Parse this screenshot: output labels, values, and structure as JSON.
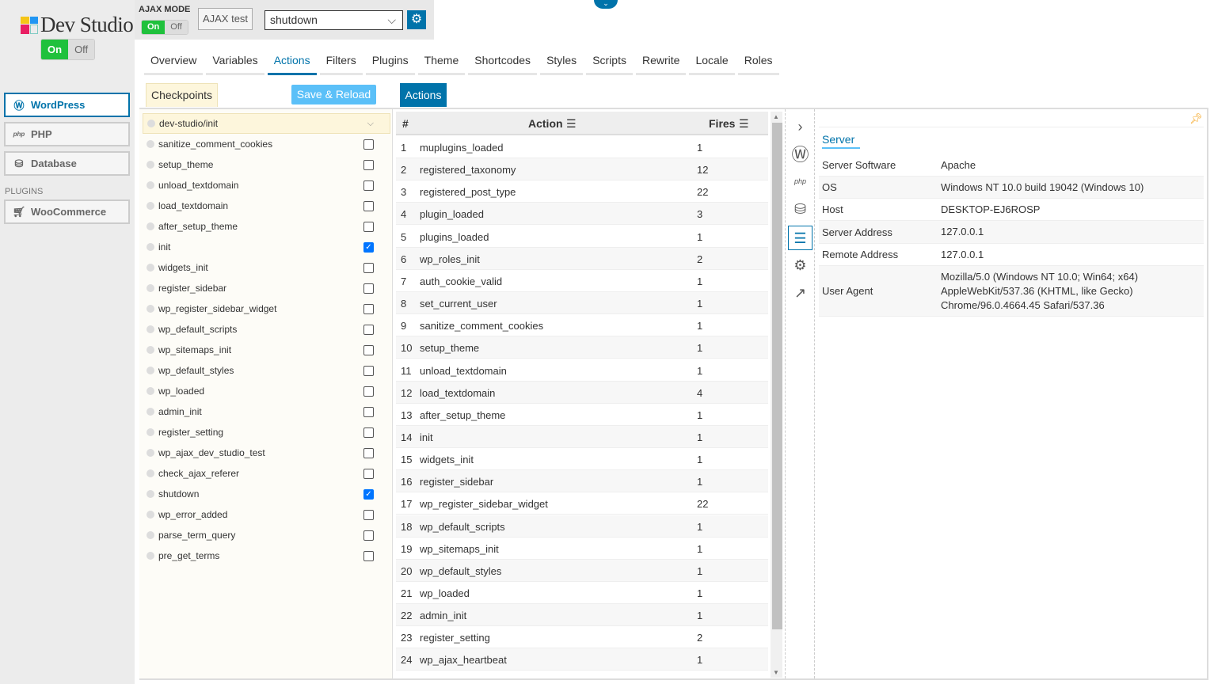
{
  "app": {
    "title": "Dev Studio",
    "on": "On",
    "off": "Off",
    "logo_colors": [
      "#f5c518",
      "#2196f3",
      "#e91e63",
      "#b2dfdb"
    ]
  },
  "sidebar": {
    "items": [
      {
        "label": "WordPress",
        "icon": "wordpress-icon",
        "active": true
      },
      {
        "label": "PHP",
        "icon": "php-icon"
      },
      {
        "label": "Database",
        "icon": "database-icon"
      }
    ],
    "plugins_label": "PLUGINS",
    "plugins": [
      {
        "label": "WooCommerce",
        "icon": "cart-icon"
      }
    ]
  },
  "toolbar": {
    "ajax_mode": "AJAX MODE",
    "on": "On",
    "off": "Off",
    "ajax_test": "AJAX test",
    "selected_hook": "shutdown"
  },
  "tabs": [
    "Overview",
    "Variables",
    "Actions",
    "Filters",
    "Plugins",
    "Theme",
    "Shortcodes",
    "Styles",
    "Scripts",
    "Rewrite",
    "Locale",
    "Roles"
  ],
  "active_tab": "Actions",
  "subbar": {
    "checkpoints": "Checkpoints",
    "save": "Save & Reload",
    "actions": "Actions"
  },
  "checkpoints": [
    {
      "name": "dev-studio/init",
      "checked": false
    },
    {
      "name": "sanitize_comment_cookies",
      "checked": false
    },
    {
      "name": "setup_theme",
      "checked": false
    },
    {
      "name": "unload_textdomain",
      "checked": false
    },
    {
      "name": "load_textdomain",
      "checked": false
    },
    {
      "name": "after_setup_theme",
      "checked": false
    },
    {
      "name": "init",
      "checked": true
    },
    {
      "name": "widgets_init",
      "checked": false
    },
    {
      "name": "register_sidebar",
      "checked": false
    },
    {
      "name": "wp_register_sidebar_widget",
      "checked": false
    },
    {
      "name": "wp_default_scripts",
      "checked": false
    },
    {
      "name": "wp_sitemaps_init",
      "checked": false
    },
    {
      "name": "wp_default_styles",
      "checked": false
    },
    {
      "name": "wp_loaded",
      "checked": false
    },
    {
      "name": "admin_init",
      "checked": false
    },
    {
      "name": "register_setting",
      "checked": false
    },
    {
      "name": "wp_ajax_dev_studio_test",
      "checked": false
    },
    {
      "name": "check_ajax_referer",
      "checked": false
    },
    {
      "name": "shutdown",
      "checked": true
    },
    {
      "name": "wp_error_added",
      "checked": false
    },
    {
      "name": "parse_term_query",
      "checked": false
    },
    {
      "name": "pre_get_terms",
      "checked": false
    }
  ],
  "table": {
    "headers": [
      "#",
      "Action",
      "Fires"
    ],
    "rows": [
      [
        "1",
        "muplugins_loaded",
        "1"
      ],
      [
        "2",
        "registered_taxonomy",
        "12"
      ],
      [
        "3",
        "registered_post_type",
        "22"
      ],
      [
        "4",
        "plugin_loaded",
        "3"
      ],
      [
        "5",
        "plugins_loaded",
        "1"
      ],
      [
        "6",
        "wp_roles_init",
        "2"
      ],
      [
        "7",
        "auth_cookie_valid",
        "1"
      ],
      [
        "8",
        "set_current_user",
        "1"
      ],
      [
        "9",
        "sanitize_comment_cookies",
        "1"
      ],
      [
        "10",
        "setup_theme",
        "1"
      ],
      [
        "11",
        "unload_textdomain",
        "1"
      ],
      [
        "12",
        "load_textdomain",
        "4"
      ],
      [
        "13",
        "after_setup_theme",
        "1"
      ],
      [
        "14",
        "init",
        "1"
      ],
      [
        "15",
        "widgets_init",
        "1"
      ],
      [
        "16",
        "register_sidebar",
        "1"
      ],
      [
        "17",
        "wp_register_sidebar_widget",
        "22"
      ],
      [
        "18",
        "wp_default_scripts",
        "1"
      ],
      [
        "19",
        "wp_sitemaps_init",
        "1"
      ],
      [
        "20",
        "wp_default_styles",
        "1"
      ],
      [
        "21",
        "wp_loaded",
        "1"
      ],
      [
        "22",
        "admin_init",
        "1"
      ],
      [
        "23",
        "register_setting",
        "2"
      ],
      [
        "24",
        "wp_ajax_heartbeat",
        "1"
      ]
    ]
  },
  "server": {
    "title": "Server",
    "rows": [
      {
        "key": "Server Software",
        "value": "Apache"
      },
      {
        "key": "OS",
        "value": "Windows NT 10.0 build 19042 (Windows 10)"
      },
      {
        "key": "Host",
        "value": "DESKTOP-EJ6ROSP"
      },
      {
        "key": "Server Address",
        "value": "127.0.0.1"
      },
      {
        "key": "Remote Address",
        "value": "127.0.0.1"
      },
      {
        "key": "User Agent",
        "value": "Mozilla/5.0 (Windows NT 10.0; Win64; x64) AppleWebKit/537.36 (KHTML, like Gecko) Chrome/96.0.4664.45 Safari/537.36"
      }
    ]
  },
  "colors": {
    "accent": "#0073aa",
    "on_green": "#1fc13c",
    "save_blue": "#5bc0f8",
    "checkpoint_bg": "#fdf6dc"
  }
}
